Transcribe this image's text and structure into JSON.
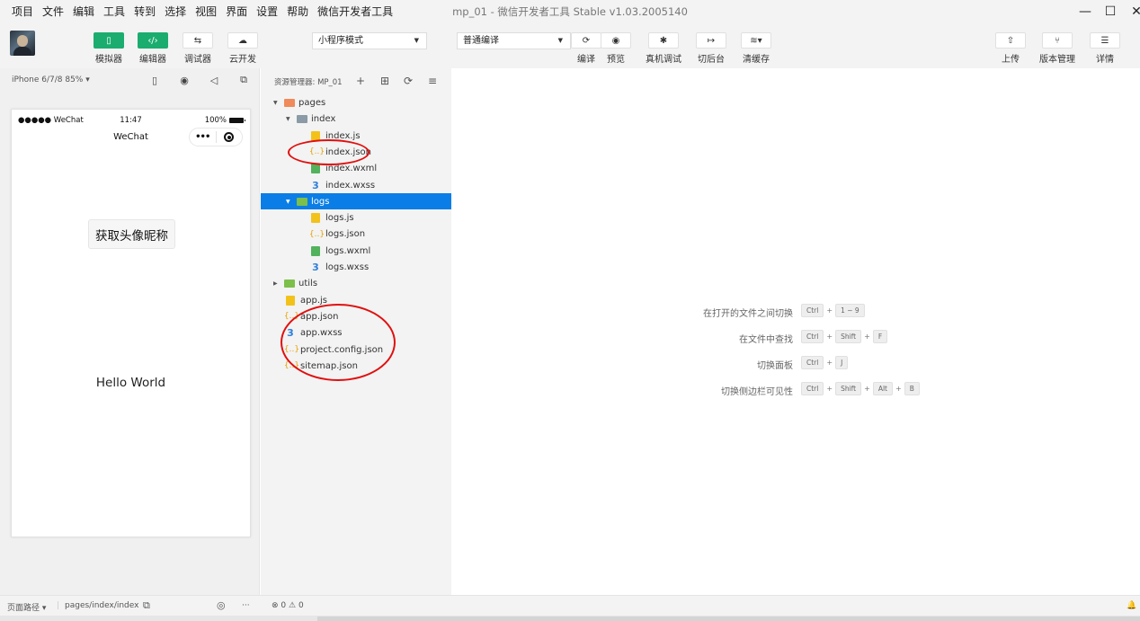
{
  "window": {
    "title": "mp_01 - 微信开发者工具 Stable v1.03.2005140",
    "minimize": "—",
    "maximize": "☐",
    "close": "✕"
  },
  "menu": [
    "项目",
    "文件",
    "编辑",
    "工具",
    "转到",
    "选择",
    "视图",
    "界面",
    "设置",
    "帮助",
    "微信开发者工具"
  ],
  "toolbar": {
    "simulator": "模拟器",
    "editor": "编辑器",
    "debugger": "调试器",
    "cloud": "云开发",
    "mode_select": "小程序模式",
    "compile_select": "普通编译",
    "compile": "编译",
    "preview": "预览",
    "real_debug": "真机调试",
    "background": "切后台",
    "clear_cache": "清缓存",
    "upload": "上传",
    "version": "版本管理",
    "details": "详情"
  },
  "simulator": {
    "device": "iPhone 6/7/8 85% ▾",
    "carrier": "●●●●● WeChat",
    "time": "11:47",
    "battery": "100%",
    "nav_title": "WeChat",
    "capsule_dots": "•••",
    "button_label": "获取头像昵称",
    "hello": "Hello World"
  },
  "explorer": {
    "title": "资源管理器: MP_01",
    "tree": [
      {
        "name": "pages",
        "type": "folder-orange",
        "depth": 0,
        "arrow": "▼"
      },
      {
        "name": "index",
        "type": "folder-gray",
        "depth": 1,
        "arrow": "▼"
      },
      {
        "name": "index.js",
        "type": "js",
        "depth": 2
      },
      {
        "name": "index.json",
        "type": "json",
        "depth": 2
      },
      {
        "name": "index.wxml",
        "type": "wxml",
        "depth": 2
      },
      {
        "name": "index.wxss",
        "type": "wxss",
        "depth": 2
      },
      {
        "name": "logs",
        "type": "folder-green",
        "depth": 1,
        "arrow": "▼",
        "selected": true
      },
      {
        "name": "logs.js",
        "type": "js",
        "depth": 2
      },
      {
        "name": "logs.json",
        "type": "json",
        "depth": 2
      },
      {
        "name": "logs.wxml",
        "type": "wxml",
        "depth": 2
      },
      {
        "name": "logs.wxss",
        "type": "wxss",
        "depth": 2
      },
      {
        "name": "utils",
        "type": "folder-green",
        "depth": 0,
        "arrow": "▶"
      },
      {
        "name": "app.js",
        "type": "js",
        "depth": 0
      },
      {
        "name": "app.json",
        "type": "json",
        "depth": 0
      },
      {
        "name": "app.wxss",
        "type": "wxss",
        "depth": 0
      },
      {
        "name": "project.config.json",
        "type": "json",
        "depth": 0
      },
      {
        "name": "sitemap.json",
        "type": "json",
        "depth": 0
      }
    ]
  },
  "shortcuts": [
    {
      "label": "在打开的文件之间切换",
      "keys": [
        "Ctrl",
        "1 ~ 9"
      ]
    },
    {
      "label": "在文件中查找",
      "keys": [
        "Ctrl",
        "Shift",
        "F"
      ]
    },
    {
      "label": "切换面板",
      "keys": [
        "Ctrl",
        "J"
      ]
    },
    {
      "label": "切换侧边栏可见性",
      "keys": [
        "Ctrl",
        "Shift",
        "Alt",
        "B"
      ]
    }
  ],
  "statusbar": {
    "page_path_label": "页面路径 ▾",
    "page_path": "pages/index/index",
    "errors": "0",
    "warnings": "0"
  },
  "icons": {
    "error": "⊗",
    "warning": "⚠",
    "bell": "🔔"
  },
  "colors": {
    "accent_green": "#1aad6f",
    "selection_blue": "#0a7ee6",
    "annotation_red": "#e10f0f"
  }
}
